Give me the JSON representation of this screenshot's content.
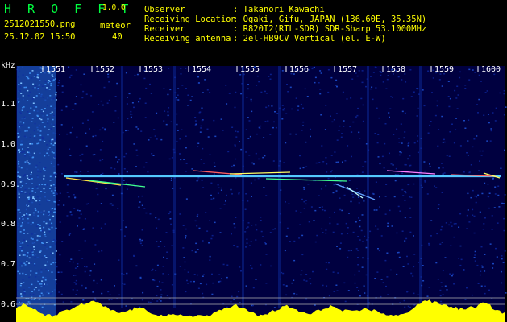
{
  "app": {
    "name": "H R O F F T",
    "version": "1.0.0",
    "filename": "2512021550.png",
    "datetime": "25.12.02 15:50",
    "meteor_label": "meteor",
    "meteor_count": "40"
  },
  "info": {
    "observer_label": "Observer",
    "observer_value": ": Takanori Kawachi",
    "location_label": "Receiving Location",
    "location_value": ": Ogaki, Gifu, JAPAN (136.60E, 35.35N)",
    "receiver_label": "Receiver",
    "receiver_value": ": R820T2(RTL-SDR) SDR-Sharp 53.1000MHz",
    "antenna_label": "Receiving antenna",
    "antenna_value": ": 2el-HB9CV Vertical (el. E-W)"
  },
  "axis": {
    "y_unit": "kHz",
    "x_ticks": [
      "1551",
      "1552",
      "1553",
      "1554",
      "1555",
      "1556",
      "1557",
      "1558",
      "1559",
      "1600"
    ],
    "y_ticks": [
      "1.1",
      "1.0",
      "0.9",
      "0.8",
      "0.7",
      "0.6"
    ]
  },
  "colors": {
    "logo": "#00ff40",
    "header_text": "#ffff00",
    "background": "#000000",
    "spectrum_bg": "#00003a",
    "carrier": "#40d0ff",
    "power_trace": "#ffff00"
  }
}
